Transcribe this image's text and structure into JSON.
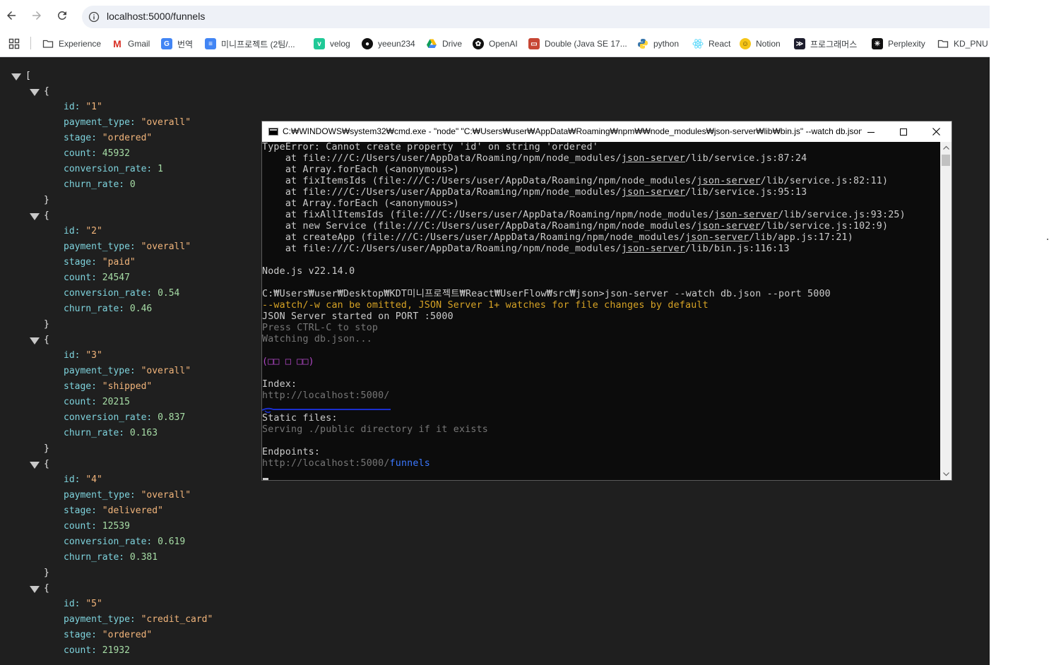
{
  "browser": {
    "url": "localhost:5000/funnels"
  },
  "bookmarks": [
    {
      "label": "Experience",
      "icon": "folder-icon"
    },
    {
      "label": "Gmail",
      "icon": "gmail-icon",
      "color": "#d93025"
    },
    {
      "label": "번역",
      "icon": "translate-icon",
      "color": "#4285f4"
    },
    {
      "label": "미니프로젝트 (2팀/...",
      "icon": "docs-icon",
      "color": "#4285f4"
    },
    {
      "label": "velog",
      "icon": "velog-icon",
      "color": "#20c997"
    },
    {
      "label": "yeeun234",
      "icon": "github-icon",
      "color": "#111111"
    },
    {
      "label": "Drive",
      "icon": "drive-icon",
      "color": "#0f9d58"
    },
    {
      "label": "OpenAI",
      "icon": "openai-icon",
      "color": "#111111"
    },
    {
      "label": "Double (Java SE 17...",
      "icon": "oracle-icon",
      "color": "#c74634"
    },
    {
      "label": "python",
      "icon": "python-icon",
      "color": "#3776ab"
    },
    {
      "label": "React",
      "icon": "react-icon",
      "color": "#61dafb"
    },
    {
      "label": "Notion",
      "icon": "notion-smiley-icon",
      "color": "#f5c518"
    },
    {
      "label": "프로그래머스",
      "icon": "programmers-icon",
      "color": "#1e1e2e"
    },
    {
      "label": "Perplexity",
      "icon": "perplexity-icon",
      "color": "#111111"
    },
    {
      "label": "KD_PNU",
      "icon": "folder-icon"
    }
  ],
  "json": {
    "open_bracket": "[",
    "records": [
      {
        "id": "\"1\"",
        "payment_type": "\"overall\"",
        "stage": "\"ordered\"",
        "count": "45932",
        "conversion_rate": "1",
        "churn_rate": "0"
      },
      {
        "id": "\"2\"",
        "payment_type": "\"overall\"",
        "stage": "\"paid\"",
        "count": "24547",
        "conversion_rate": "0.54",
        "churn_rate": "0.46"
      },
      {
        "id": "\"3\"",
        "payment_type": "\"overall\"",
        "stage": "\"shipped\"",
        "count": "20215",
        "conversion_rate": "0.837",
        "churn_rate": "0.163"
      },
      {
        "id": "\"4\"",
        "payment_type": "\"overall\"",
        "stage": "\"delivered\"",
        "count": "12539",
        "conversion_rate": "0.619",
        "churn_rate": "0.381"
      },
      {
        "id": "\"5\"",
        "payment_type": "\"credit_card\"",
        "stage": "\"ordered\"",
        "count": "21932"
      }
    ],
    "keys": {
      "id": "id:",
      "payment_type": "payment_type:",
      "stage": "stage:",
      "count": "count:",
      "conversion_rate": "conversion_rate:",
      "churn_rate": "churn_rate:"
    }
  },
  "cmd": {
    "title": "C:₩WINDOWS₩system32₩cmd.exe  - \"node\"   \"C:₩Users₩user₩AppData₩Roaming₩npm₩₩node_modules₩json-server₩lib₩bin.js\" --watch db.json --port 5000",
    "lines": {
      "l0": "TypeError: Cannot create property 'id' on string 'ordered'",
      "l1a": "    at file:///C:/Users/user/AppData/Roaming/npm/node_modules/",
      "l1b": "json-server",
      "l1c": "/lib/service.js:87:24",
      "l2": "    at Array.forEach (<anonymous>)",
      "l3a": "    at fixItemsIds (file:///C:/Users/user/AppData/Roaming/npm/node_modules/",
      "l3b": "json-server",
      "l3c": "/lib/service.js:82:11)",
      "l4a": "    at file:///C:/Users/user/AppData/Roaming/npm/node_modules/",
      "l4b": "json-server",
      "l4c": "/lib/service.js:95:13",
      "l5": "    at Array.forEach (<anonymous>)",
      "l6a": "    at fixAllItemsIds (file:///C:/Users/user/AppData/Roaming/npm/node_modules/",
      "l6b": "json-server",
      "l6c": "/lib/service.js:93:25)",
      "l7a": "    at new Service (file:///C:/Users/user/AppData/Roaming/npm/node_modules/",
      "l7b": "json-server",
      "l7c": "/lib/service.js:102:9)",
      "l8a": "    at createApp (file:///C:/Users/user/AppData/Roaming/npm/node_modules/",
      "l8b": "json-server",
      "l8c": "/lib/app.js:17:21)",
      "l9a": "    at file:///C:/Users/user/AppData/Roaming/npm/node_modules/",
      "l9b": "json-server",
      "l9c": "/lib/bin.js:116:13",
      "node": "Node.js v22.14.0",
      "prompt": "C:₩Users₩user₩Desktop₩KDT미니프로젝트₩React₩UserFlow₩src₩json>json-server --watch db.json --port 5000",
      "warn": "--watch/-w can be omitted, JSON Server 1+ watches for file changes by default",
      "started": "JSON Server started on PORT :5000",
      "press": "Press CTRL-C to stop",
      "watching": "Watching db.json...",
      "kaomoji": "(□□ □ □□)",
      "index_label": "Index:",
      "index_url": "http://localhost:5000/",
      "static_label": "Static files:",
      "static_text": "Serving ./public directory if it exists",
      "endpoints_label": "Endpoints:",
      "endpoint_base": "http://localhost:5000/",
      "endpoint_path": "funnels"
    }
  }
}
